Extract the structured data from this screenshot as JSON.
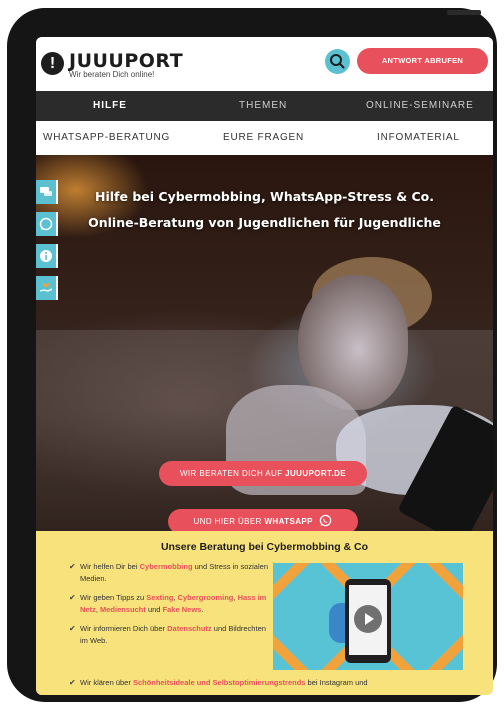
{
  "brand": {
    "name": "JUUUPORT",
    "tagline": "Wir beraten Dich online!",
    "logo_icon": "exclamation-bubble-icon"
  },
  "header": {
    "search_icon": "search-icon",
    "cta_label": "ANTWORT ABRUFEN"
  },
  "nav_primary": [
    {
      "label": "HILFE",
      "active": true
    },
    {
      "label": "THEMEN",
      "active": false
    },
    {
      "label": "ONLINE-SEMINARE",
      "active": false
    }
  ],
  "nav_secondary": [
    {
      "label": "WHATSAPP-BERATUNG"
    },
    {
      "label": "EURE FRAGEN"
    },
    {
      "label": "INFOMATERIAL"
    }
  ],
  "side_tabs": [
    {
      "icon": "chat-icon"
    },
    {
      "icon": "whatsapp-icon"
    },
    {
      "icon": "info-icon"
    },
    {
      "icon": "heart-hand-icon"
    }
  ],
  "hero": {
    "title_line1": "Hilfe bei Cybermobbing, WhatsApp-Stress & Co.",
    "title_line2": "Online-Beratung von Jugendlichen für Jugendliche",
    "button1_text": "WIR BERATEN DICH AUF ",
    "button1_bold": "JUUUPORT.DE",
    "button2_text": "UND HIER ÜBER ",
    "button2_bold": "WHATSAPP"
  },
  "info": {
    "title": "Unsere Beratung bei Cybermobbing & Co",
    "b1_pre": "Wir helfen Dir bei ",
    "b1_hl": "Cybermobbing",
    "b1_post": " und Stress in sozialen Medien.",
    "b2_pre": "Wir geben Tipps zu ",
    "b2_hl1": "Sexting",
    "b2_hl2": "Cybergrooming",
    "b2_hl3": "Hass im Netz",
    "b2_hl4": "Mediensucht",
    "b2_and": " und ",
    "b2_hl5": "Fake News",
    "b3_pre": "Wir informieren Dich über ",
    "b3_hl": "Datenschutz",
    "b3_post": " und Bildrechten im Web.",
    "b4_pre": "Wir klären über ",
    "b4_hl": "Schönheitsideale und Selbstoptimierungstrends",
    "b4_post": " bei Instagram und",
    "check_icon": "checkmark-icon",
    "illustration": "phone-video-illustration"
  },
  "colors": {
    "accent_red": "#e8505b",
    "accent_teal": "#5bc0d0",
    "nav_dark": "#2b2b2b",
    "info_yellow": "#f8e27c"
  }
}
